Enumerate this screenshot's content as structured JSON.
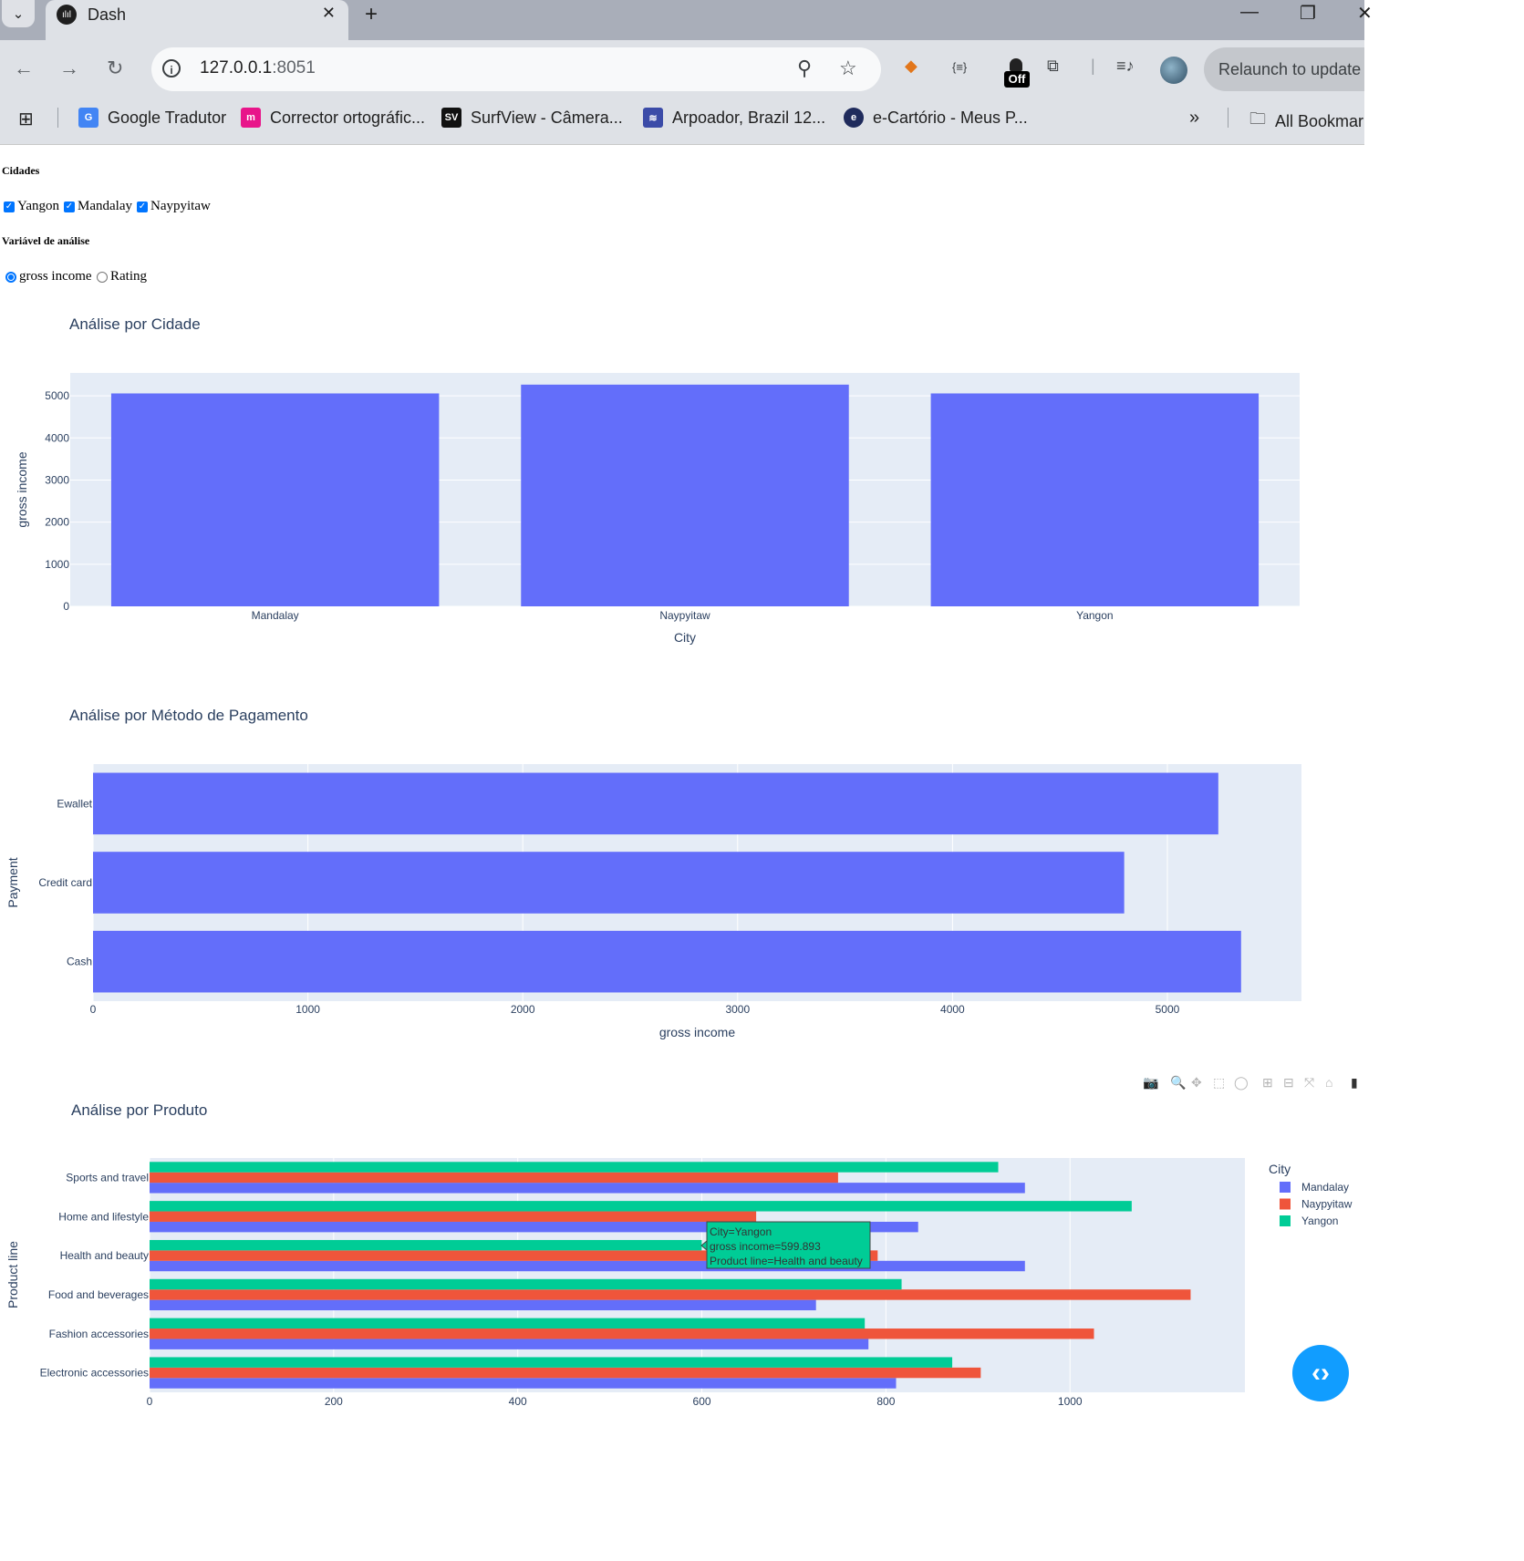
{
  "browser": {
    "tab_title": "Dash",
    "tab_favicon": "ılıl",
    "url_host": "127.0.0.1",
    "url_port": ":8051",
    "relaunch_label": "Relaunch to update",
    "bookmarks": [
      {
        "label": "Google Tradutor",
        "icon": "google-translate-icon",
        "color": "#4285f4",
        "glyph": "G"
      },
      {
        "label": "Corrector ortográfic...",
        "icon": "corrector-icon",
        "color": "#e8158a",
        "glyph": "m"
      },
      {
        "label": "SurfView - Câmera...",
        "icon": "surfview-icon",
        "color": "#111111",
        "glyph": "SV"
      },
      {
        "label": "Arpoador, Brazil 12...",
        "icon": "wave-icon",
        "color": "#3b4ba8",
        "glyph": "≋"
      },
      {
        "label": "e-Cartório - Meus P...",
        "icon": "ecartorio-icon",
        "color": "#1f2b5c",
        "glyph": "e"
      }
    ],
    "all_bookmarks_label": "All Bookmar",
    "off_badge": "Off"
  },
  "filters": {
    "cities_label": "Cidades",
    "cities": [
      {
        "label": "Yangon",
        "checked": true
      },
      {
        "label": "Mandalay",
        "checked": true
      },
      {
        "label": "Naypyitaw",
        "checked": true
      }
    ],
    "variable_label": "Variável de análise",
    "variables": [
      {
        "label": "gross income",
        "selected": true
      },
      {
        "label": "Rating",
        "selected": false
      }
    ]
  },
  "tooltip": {
    "line1": "City=Yangon",
    "line2": "gross income=599.893",
    "line3": "Product line=Health and beauty"
  },
  "chart_data": [
    {
      "type": "bar",
      "title": "Análise por Cidade",
      "xlabel": "City",
      "ylabel": "gross income",
      "categories": [
        "Mandalay",
        "Naypyitaw",
        "Yangon"
      ],
      "values": [
        5057,
        5266,
        5057
      ],
      "ylim": [
        0,
        5544
      ],
      "yticks": [
        0,
        1000,
        2000,
        3000,
        4000,
        5000
      ],
      "bar_color": "#636efa",
      "grid": true
    },
    {
      "type": "bar",
      "orientation": "horizontal",
      "title": "Análise por Método de Pagamento",
      "xlabel": "gross income",
      "ylabel": "Payment",
      "categories": [
        "Cash",
        "Credit card",
        "Ewallet"
      ],
      "values": [
        5343,
        4799,
        5237
      ],
      "xlim": [
        0,
        5624
      ],
      "xticks": [
        0,
        1000,
        2000,
        3000,
        4000,
        5000
      ],
      "bar_color": "#636efa",
      "grid": true
    },
    {
      "type": "bar",
      "orientation": "horizontal",
      "title": "Análise por Produto",
      "ylabel": "Product line",
      "legend_title": "City",
      "legend_position": "right",
      "categories": [
        "Electronic accessories",
        "Fashion accessories",
        "Food and beverages",
        "Health and beauty",
        "Home and lifestyle",
        "Sports and travel"
      ],
      "series": [
        {
          "name": "Mandalay",
          "color": "#636efa",
          "values": [
            811,
            781,
            724,
            951,
            835,
            951
          ]
        },
        {
          "name": "Naypyitaw",
          "color": "#ef553b",
          "values": [
            903,
            1026,
            1131,
            791,
            659,
            748
          ]
        },
        {
          "name": "Yangon",
          "color": "#00cc96",
          "values": [
            872,
            777,
            817,
            599.893,
            1067,
            922
          ]
        }
      ],
      "xlim": [
        0,
        1190
      ],
      "xticks": [
        0,
        200,
        400,
        600,
        800,
        1000
      ],
      "grid": true
    }
  ]
}
